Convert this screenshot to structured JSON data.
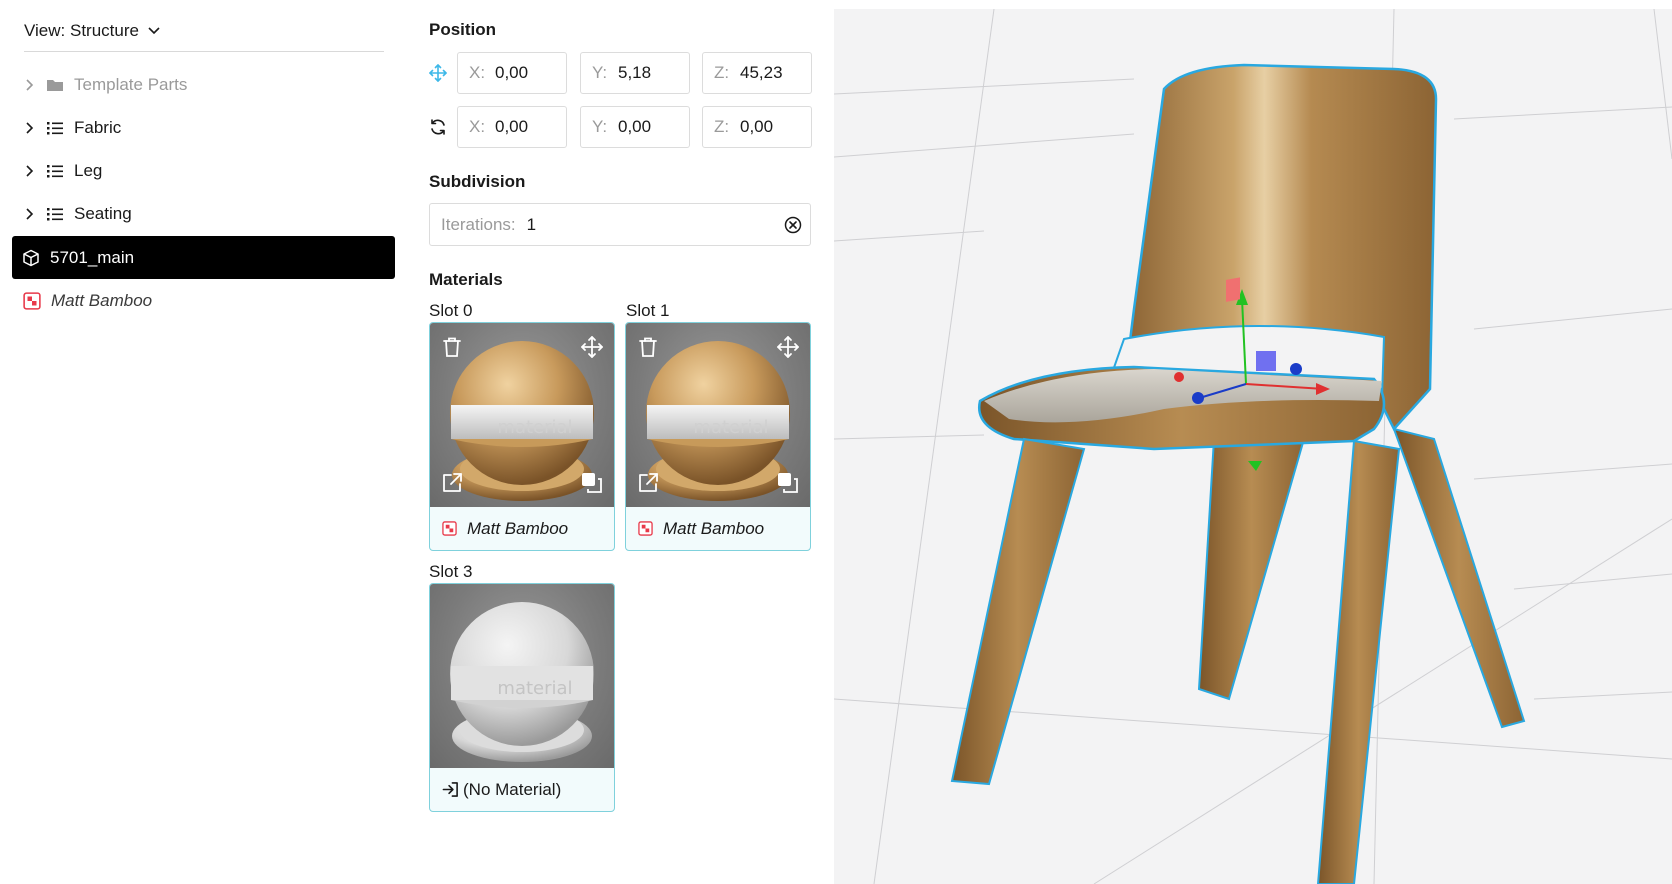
{
  "tree": {
    "view_label": "View: Structure",
    "items": [
      {
        "label": "Template Parts",
        "icon": "folder-icon",
        "state": "disabled"
      },
      {
        "label": "Fabric",
        "icon": "list-icon",
        "state": "normal"
      },
      {
        "label": "Leg",
        "icon": "list-icon",
        "state": "normal"
      },
      {
        "label": "Seating",
        "icon": "list-icon",
        "state": "normal"
      },
      {
        "label": "5701_main",
        "icon": "cube-icon",
        "state": "selected"
      },
      {
        "label": "Matt Bamboo",
        "icon": "material-icon",
        "state": "material"
      }
    ]
  },
  "position": {
    "title": "Position",
    "translate": {
      "x_label": "X:",
      "x": "0,00",
      "y_label": "Y:",
      "y": "5,18",
      "z_label": "Z:",
      "z": "45,23"
    },
    "rotate": {
      "x_label": "X:",
      "x": "0,00",
      "y_label": "Y:",
      "y": "0,00",
      "z_label": "Z:",
      "z": "0,00"
    }
  },
  "subdivision": {
    "title": "Subdivision",
    "iterations_label": "Iterations:",
    "iterations_value": "1"
  },
  "materials": {
    "title": "Materials",
    "slots": [
      {
        "label": "Slot 0",
        "material": "Matt Bamboo",
        "preview": "bamboo"
      },
      {
        "label": "Slot 1",
        "material": "Matt Bamboo",
        "preview": "bamboo"
      },
      {
        "label": "Slot 3",
        "material": "(No Material)",
        "preview": "none"
      }
    ],
    "preview_watermark": "material"
  },
  "colors": {
    "accent": "#3db8e8",
    "selection_outline": "#29a8e0",
    "material_icon": "#e8394a",
    "card_border": "#7fd1dc"
  }
}
